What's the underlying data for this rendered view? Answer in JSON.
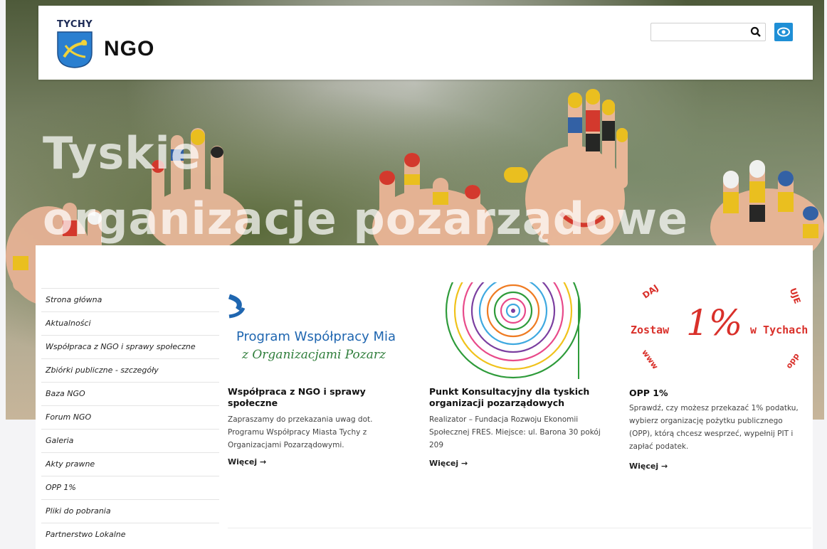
{
  "header": {
    "logo_city": "TYCHY",
    "logo_title": "NGO",
    "search": {
      "value": "",
      "placeholder": ""
    }
  },
  "hero": {
    "line1": "Tyskie",
    "line2": "organizacje pozarządowe"
  },
  "sidebar": {
    "items": [
      {
        "label": "Strona główna"
      },
      {
        "label": "Aktualności"
      },
      {
        "label": "Współpraca z NGO i sprawy społeczne"
      },
      {
        "label": "Zbiórki publiczne - szczegóły"
      },
      {
        "label": "Baza NGO"
      },
      {
        "label": "Forum NGO"
      },
      {
        "label": "Galeria"
      },
      {
        "label": "Akty prawne"
      },
      {
        "label": "OPP 1%"
      },
      {
        "label": "Pliki do pobrania"
      },
      {
        "label": "Partnerstwo Lokalne"
      }
    ]
  },
  "cards": [
    {
      "img_line1": "Program Współpracy Mia",
      "img_line2": "z Organizacjami Pozarz",
      "title": "Współpraca z NGO i sprawy społeczne",
      "desc": "Zapraszamy do przekazania uwag dot. Programu Współpracy Miasta Tychy z Organizacjami Pozarządowymi.",
      "more": "Więcej →"
    },
    {
      "title": "Punkt Konsultacyjny dla tyskich organizacji pozarządowych",
      "desc": "Realizator – Fundacja Rozwoju Ekonomii Społecznej FRES. Miejsce: ul. Barona 30 pokój 209",
      "more": "Więcej →"
    },
    {
      "img_left": "Zostaw",
      "img_big": "1%",
      "img_right": "w Tychach",
      "img_arc_top": "DAJ",
      "img_arc_right": "UJE",
      "img_arc_bottom_left": "www",
      "img_arc_bottom_right": "opp",
      "title": "OPP 1%",
      "desc": "Sprawdź, czy możesz przekazać 1% podatku, wybierz organizację pożytku publicznego (OPP), którą chcesz wesprzeć, wypełnij PIT i zapłać podatek.",
      "more": "Więcej →"
    }
  ],
  "colors": {
    "accent": "#1f8fd6",
    "opp_red": "#d9302a",
    "program_blue": "#1f66b0",
    "program_green": "#2e7d3a"
  }
}
